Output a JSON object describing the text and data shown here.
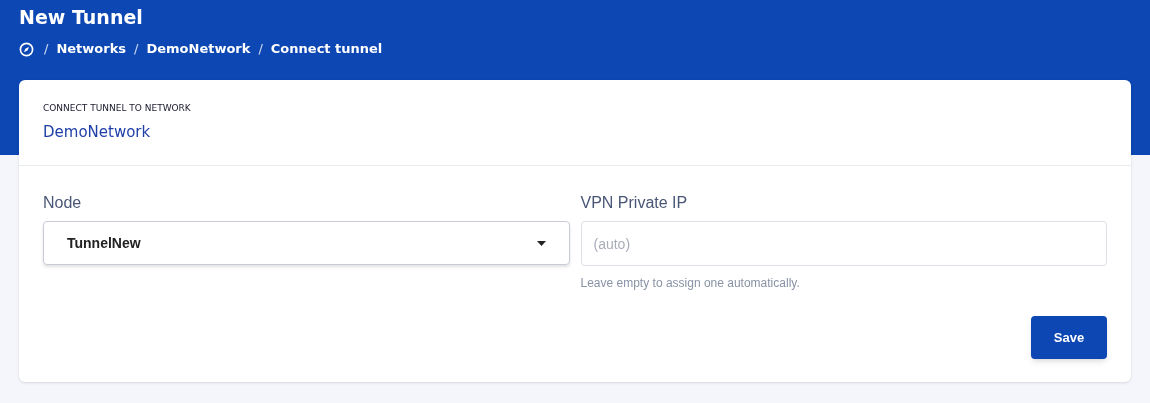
{
  "page": {
    "title": "New Tunnel"
  },
  "breadcrumb": [
    {
      "separator": "/",
      "label": "Networks"
    },
    {
      "separator": "/",
      "label": "DemoNetwork"
    },
    {
      "separator": "/",
      "label": "Connect tunnel"
    }
  ],
  "card": {
    "subtitle": "CONNECT TUNNEL TO NETWORK",
    "title": "DemoNetwork"
  },
  "form": {
    "node": {
      "label": "Node",
      "value": "TunnelNew"
    },
    "vpn_ip": {
      "label": "VPN Private IP",
      "placeholder": "(auto)",
      "help": "Leave empty to assign one automatically."
    },
    "save_button": "Save"
  }
}
